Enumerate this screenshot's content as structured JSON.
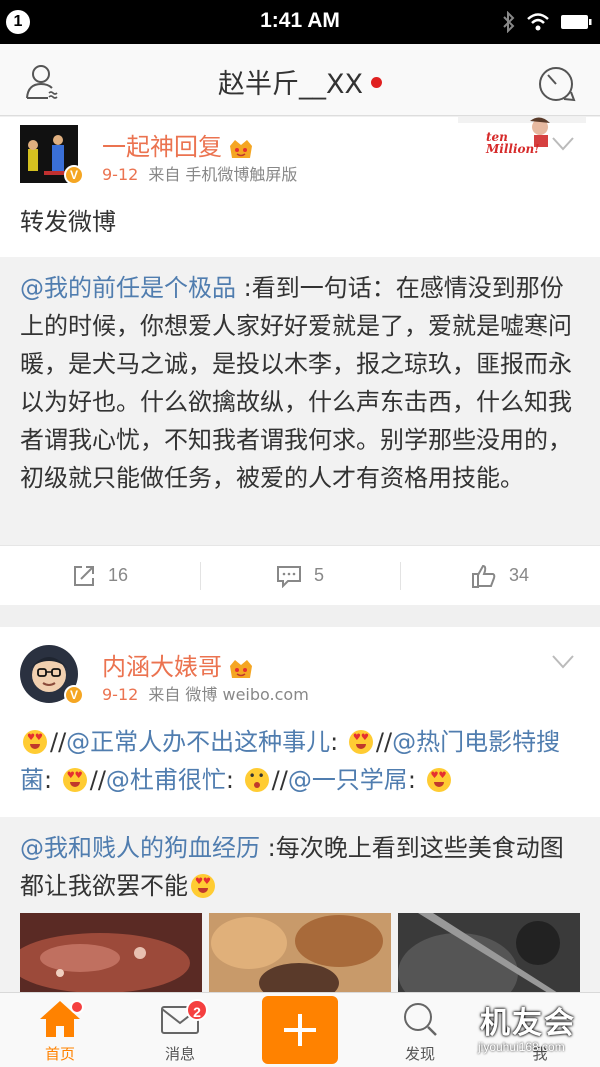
{
  "status_bar": {
    "notification_count": "1",
    "time": "1:41 AM"
  },
  "nav": {
    "title": "赵半斤__XX"
  },
  "posts": [
    {
      "author": "一起神回复",
      "date": "9-12",
      "source": "来自 手机微博触屏版",
      "text": "转发微博",
      "quote": {
        "mention": "@我的前任是个极品",
        "text": " :看到一句话：在感情没到那份上的时候，你想爱人家好好爱就是了，爱就是嘘寒问暖，是犬马之诚，是投以木李，报之琼玖，匪报而永以为好也。什么欲擒故纵，什么声东击西，什么知我者谓我心忧，不知我者谓我何求。别学那些没用的，初级就只能做任务，被爱的人才有资格用技能。"
      },
      "sticker_text": "ten Million!",
      "actions": {
        "repost": "16",
        "comment": "5",
        "like": "34"
      }
    },
    {
      "author": "内涵大婊哥",
      "date": "9-12",
      "source": "来自 微博 weibo.com",
      "text_parts": {
        "sep": "//",
        "m1": "@正常人办不出这种事儿",
        "colon": ":",
        "m2": "@热门电影特搜菌",
        "m3": "@杜甫很忙",
        "m4": "@一只学屌"
      },
      "quote": {
        "mention": "@我和贱人的狗血经历",
        "text": " :每次晚上看到这些美食动图都让我欲罢不能"
      }
    }
  ],
  "tabs": [
    {
      "label": "首页"
    },
    {
      "label": "消息",
      "badge": "2"
    },
    {
      "label": ""
    },
    {
      "label": "发现"
    },
    {
      "label": "我"
    }
  ],
  "watermark": {
    "name": "机友会",
    "url": "jiyouhui168.com"
  },
  "colors": {
    "accent": "#ff8200",
    "username": "#eb7350",
    "mention": "#507daf",
    "badge": "#f54040"
  }
}
